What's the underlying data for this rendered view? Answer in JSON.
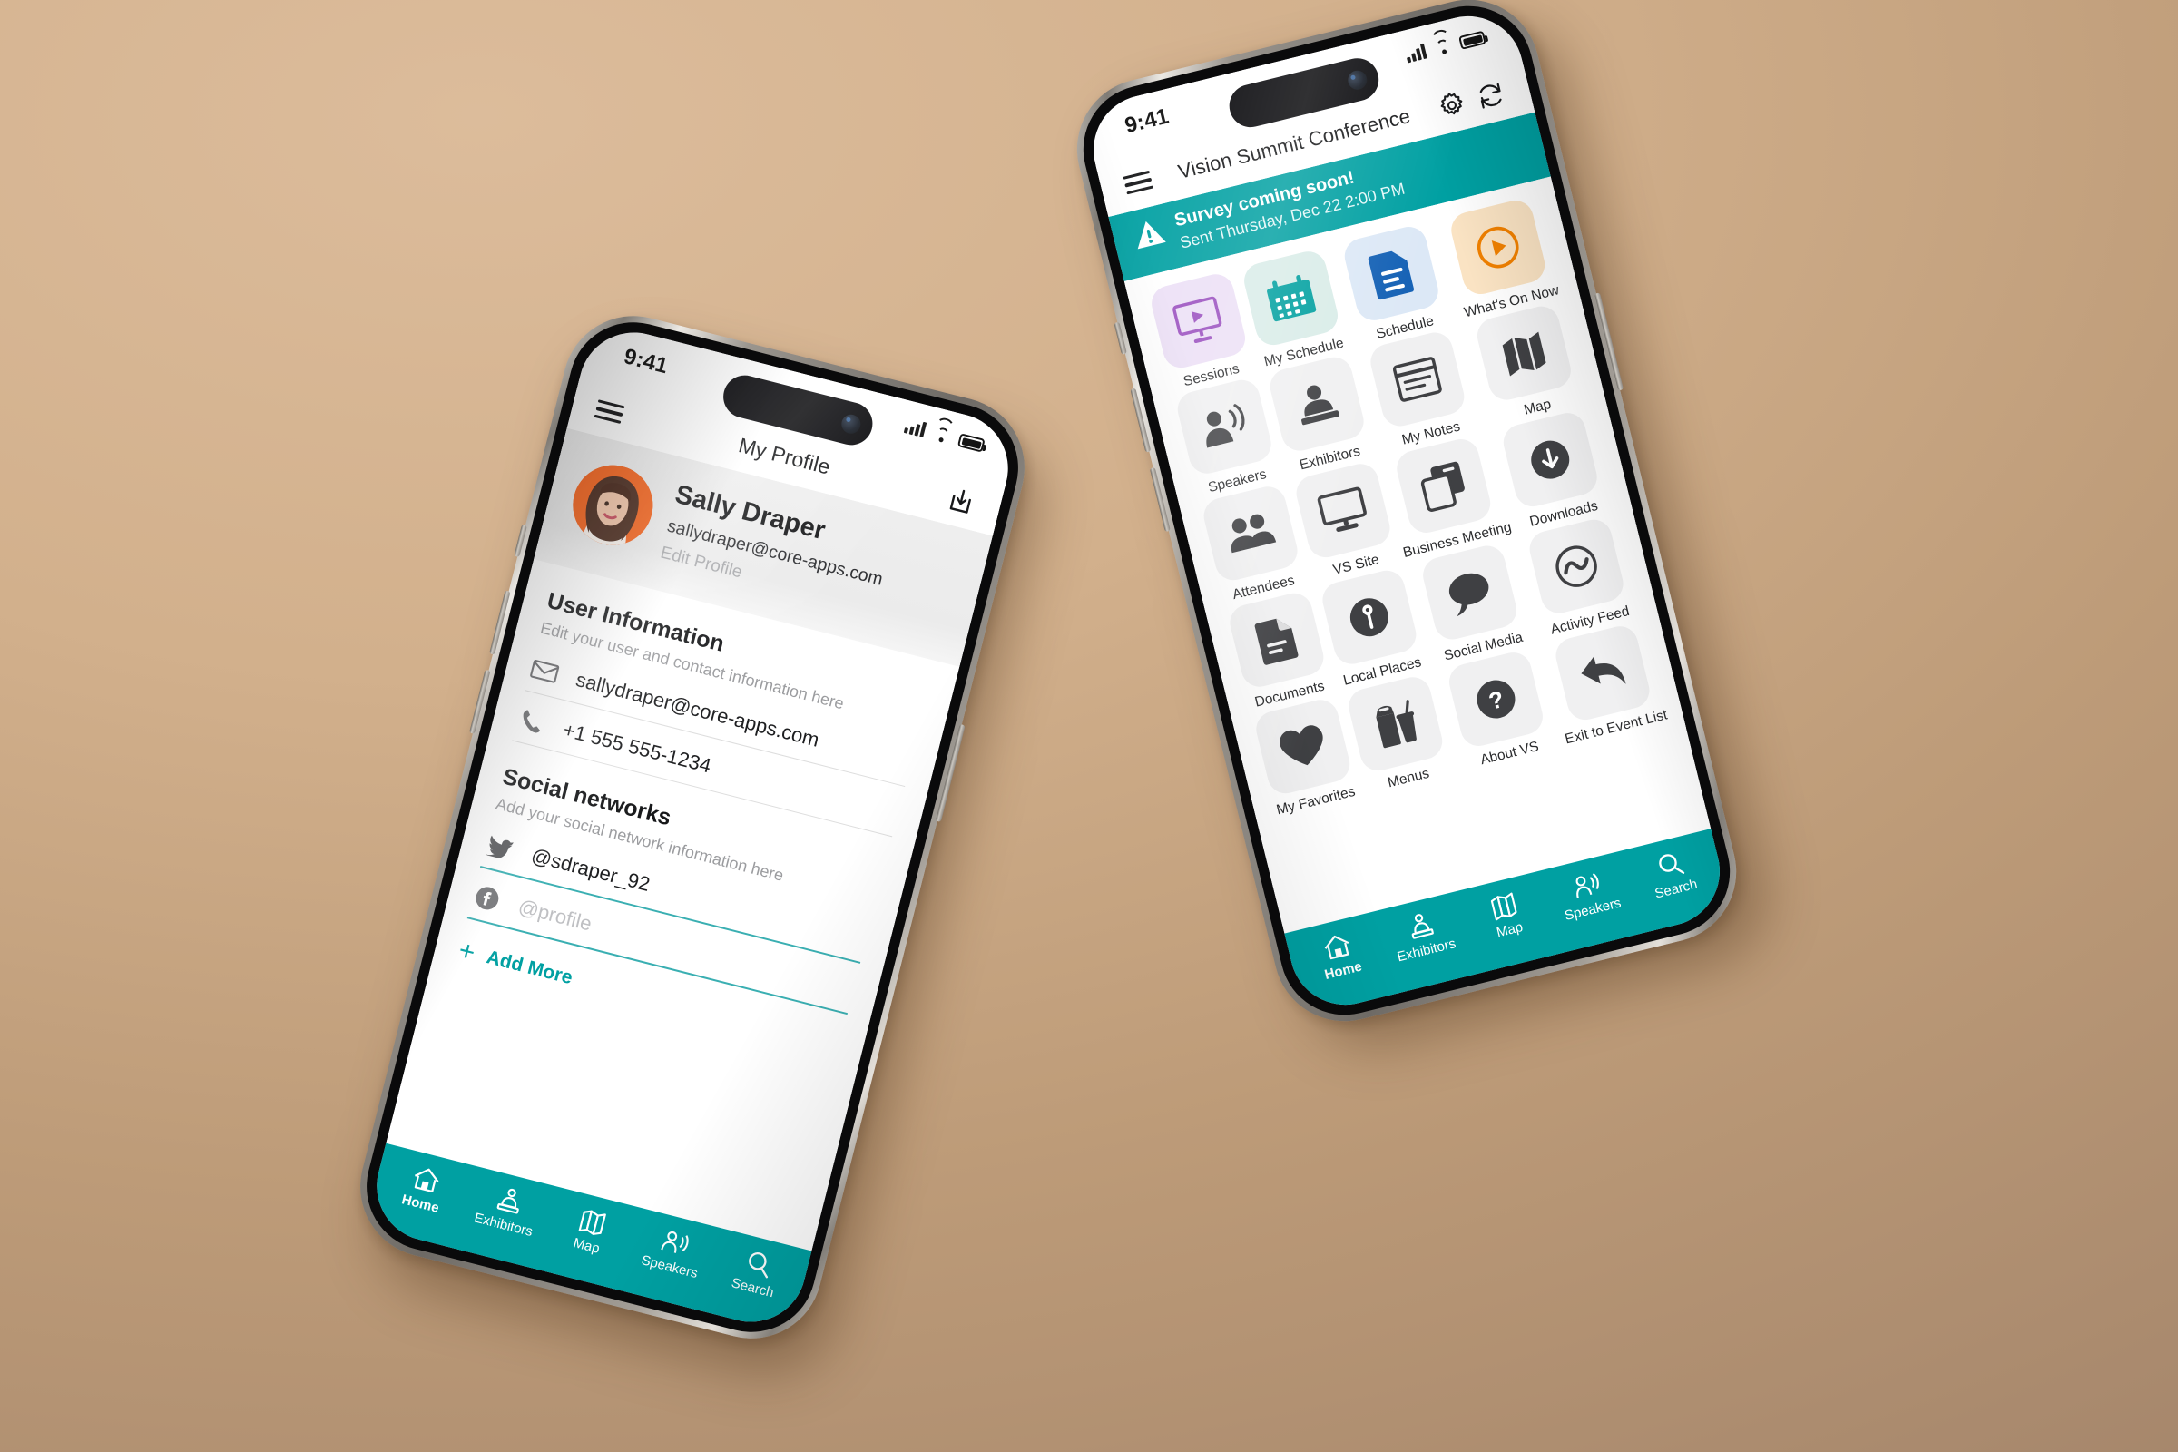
{
  "theme": {
    "accent_teal": "#00a0a2",
    "background_from": "#dcbc9b",
    "background_to": "#a3846a",
    "tile_grey": "#f0f0f1",
    "icon_dark": "#3f4043",
    "avatar_bg": "#f4641e"
  },
  "left_phone": {
    "status_bar": {
      "time": "9:41",
      "signal_icon": "cellular-bars-icon",
      "wifi_icon": "wifi-icon",
      "battery_icon": "battery-full-icon"
    },
    "app_bar": {
      "menu_icon": "hamburger-menu-icon",
      "title": "My Profile",
      "action_icon": "save-to-tray-icon"
    },
    "profile": {
      "avatar_icon": "user-avatar-photo",
      "name": "Sally Draper",
      "email": "sallydraper@core-apps.com",
      "edit_link": "Edit Profile"
    },
    "user_information": {
      "heading": "User Information",
      "subheading": "Edit your user and contact information here",
      "fields": [
        {
          "icon": "envelope-icon",
          "value": "sallydraper@core-apps.com",
          "placeholder": ""
        },
        {
          "icon": "phone-icon",
          "value": "+1 555 555-1234",
          "placeholder": ""
        }
      ]
    },
    "social_networks": {
      "heading": "Social networks",
      "subheading": "Add your social network information here",
      "fields": [
        {
          "icon": "twitter-icon",
          "value": "@sdraper_92",
          "placeholder": "@profile",
          "underline": "teal"
        },
        {
          "icon": "facebook-icon",
          "value": "",
          "placeholder": "@profile",
          "underline": "teal"
        }
      ],
      "add_more_label": "Add More",
      "add_more_icon": "plus-icon"
    },
    "bottom_nav": [
      {
        "label": "Home",
        "icon": "home-icon",
        "active": true
      },
      {
        "label": "Exhibitors",
        "icon": "exhibitor-booth-icon",
        "active": false
      },
      {
        "label": "Map",
        "icon": "map-folded-icon",
        "active": false
      },
      {
        "label": "Speakers",
        "icon": "speaker-person-icon",
        "active": false
      },
      {
        "label": "Search",
        "icon": "search-icon",
        "active": false
      }
    ]
  },
  "right_phone": {
    "status_bar": {
      "time": "9:41",
      "signal_icon": "cellular-bars-icon",
      "wifi_icon": "wifi-icon",
      "battery_icon": "battery-full-icon"
    },
    "app_bar": {
      "menu_icon": "hamburger-menu-icon",
      "title": "Vision Summit Conference",
      "settings_icon": "gear-icon",
      "refresh_icon": "refresh-sync-icon"
    },
    "banner": {
      "alert_icon": "warning-triangle-icon",
      "title": "Survey coming soon!",
      "subtitle": "Sent Thursday, Dec 22 2:00 PM"
    },
    "grid_items": [
      {
        "label": "Sessions",
        "icon": "monitor-play-icon",
        "tile_bg": "#ece0f6",
        "icon_color": "#9b51c0"
      },
      {
        "label": "My Schedule",
        "icon": "calendar-icon",
        "tile_bg": "#d9ece8",
        "icon_color": "#00a0a0"
      },
      {
        "label": "Schedule",
        "icon": "document-lines-icon",
        "tile_bg": "#dce8f6",
        "icon_color": "#1461b5"
      },
      {
        "label": "What's On Now",
        "icon": "play-circle-icon",
        "tile_bg": "#fae3c3",
        "icon_color": "#f08000"
      },
      {
        "label": "Speakers",
        "icon": "speaker-person-icon",
        "tile_bg": "#f0f0f1",
        "icon_color": "#3f4043"
      },
      {
        "label": "Exhibitors",
        "icon": "exhibitor-booth-icon",
        "tile_bg": "#f0f0f1",
        "icon_color": "#3f4043"
      },
      {
        "label": "My Notes",
        "icon": "notes-icon",
        "tile_bg": "#f0f0f1",
        "icon_color": "#3f4043"
      },
      {
        "label": "Map",
        "icon": "map-folded-icon",
        "tile_bg": "#f0f0f1",
        "icon_color": "#3f4043"
      },
      {
        "label": "Attendees",
        "icon": "people-group-icon",
        "tile_bg": "#f0f0f1",
        "icon_color": "#3f4043"
      },
      {
        "label": "VS Site",
        "icon": "desktop-monitor-icon",
        "tile_bg": "#f0f0f1",
        "icon_color": "#3f4043"
      },
      {
        "label": "Business Meeting",
        "icon": "two-cards-icon",
        "tile_bg": "#f0f0f1",
        "icon_color": "#3f4043"
      },
      {
        "label": "Downloads",
        "icon": "download-circle-icon",
        "tile_bg": "#f0f0f1",
        "icon_color": "#3f4043"
      },
      {
        "label": "Documents",
        "icon": "document-folded-icon",
        "tile_bg": "#f0f0f1",
        "icon_color": "#3f4043"
      },
      {
        "label": "Local Places",
        "icon": "map-pin-circle-icon",
        "tile_bg": "#f0f0f1",
        "icon_color": "#3f4043"
      },
      {
        "label": "Social Media",
        "icon": "speech-bubble-icon",
        "tile_bg": "#f0f0f1",
        "icon_color": "#3f4043"
      },
      {
        "label": "Activity Feed",
        "icon": "activity-wave-icon",
        "tile_bg": "#f0f0f1",
        "icon_color": "#3f4043"
      },
      {
        "label": "My Favorites",
        "icon": "heart-icon",
        "tile_bg": "#f0f0f1",
        "icon_color": "#3f4043"
      },
      {
        "label": "Menus",
        "icon": "food-drink-icon",
        "tile_bg": "#f0f0f1",
        "icon_color": "#3f4043"
      },
      {
        "label": "About VS",
        "icon": "question-circle-icon",
        "tile_bg": "#f0f0f1",
        "icon_color": "#3f4043"
      },
      {
        "label": "Exit to Event List",
        "icon": "back-arrow-icon",
        "tile_bg": "#f0f0f1",
        "icon_color": "#3f4043"
      }
    ],
    "bottom_nav": [
      {
        "label": "Home",
        "icon": "home-icon",
        "active": true
      },
      {
        "label": "Exhibitors",
        "icon": "exhibitor-booth-icon",
        "active": false
      },
      {
        "label": "Map",
        "icon": "map-folded-icon",
        "active": false
      },
      {
        "label": "Speakers",
        "icon": "speaker-person-icon",
        "active": false
      },
      {
        "label": "Search",
        "icon": "search-icon",
        "active": false
      }
    ]
  }
}
